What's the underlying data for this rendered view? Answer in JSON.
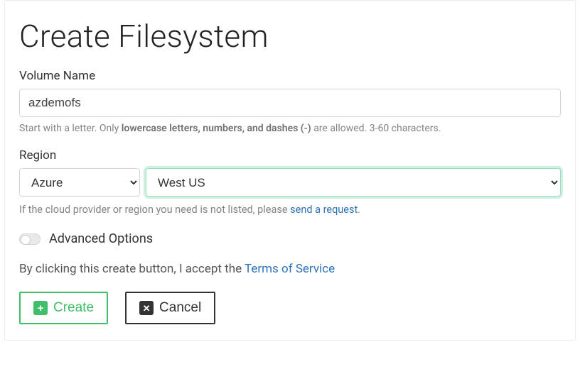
{
  "page": {
    "title": "Create Filesystem"
  },
  "volume": {
    "label": "Volume Name",
    "value": "azdemofs",
    "help_prefix": "Start with a letter. Only ",
    "help_strong": "lowercase letters, numbers, and dashes (-)",
    "help_suffix": " are allowed. 3-60 characters."
  },
  "region": {
    "label": "Region",
    "provider_selected": "Azure",
    "region_selected": "West US",
    "help_prefix": "If the cloud provider or region you need is not listed, please ",
    "help_link": "send a request",
    "help_suffix": "."
  },
  "advanced": {
    "label": "Advanced Options"
  },
  "accept": {
    "prefix": "By clicking this create button, I accept the ",
    "link": "Terms of Service"
  },
  "buttons": {
    "create": "Create",
    "cancel": "Cancel"
  }
}
